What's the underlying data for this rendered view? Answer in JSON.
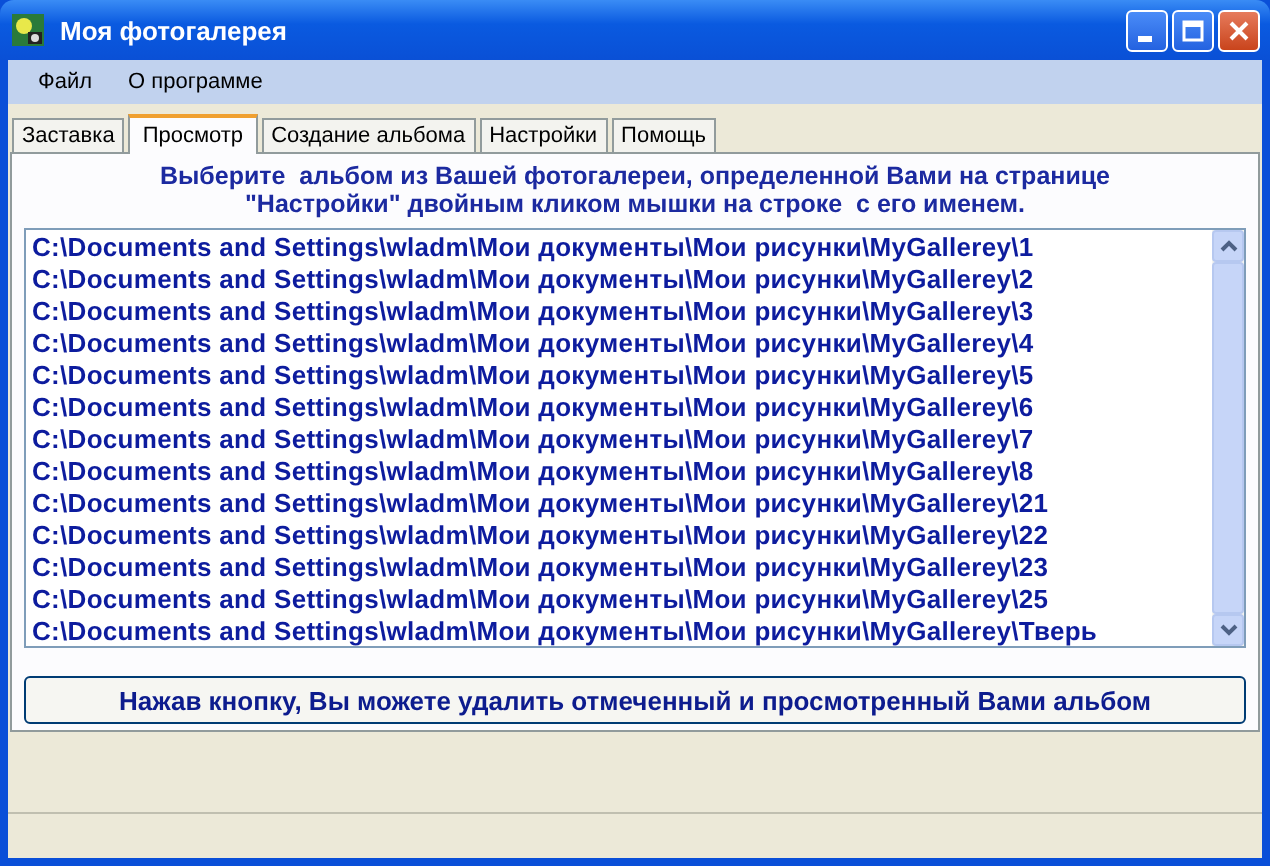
{
  "window": {
    "title": "Моя фотогалерея"
  },
  "menu": [
    "Файл",
    "О программе"
  ],
  "tabs": [
    {
      "label": "Заставка",
      "selected": false
    },
    {
      "label": "Просмотр",
      "selected": true
    },
    {
      "label": "Создание альбома",
      "selected": false
    },
    {
      "label": "Настройки",
      "selected": false
    },
    {
      "label": "Помощь",
      "selected": false
    }
  ],
  "instruction": [
    "Выберите  альбом из Вашей фотогалереи, определенной Вами на странице",
    "\"Настройки\" двойным кликом мышки на строке  с его именем."
  ],
  "albums": [
    "C:\\Documents and Settings\\wladm\\Мои документы\\Мои рисунки\\MyGallerey\\1",
    "C:\\Documents and Settings\\wladm\\Мои документы\\Мои рисунки\\MyGallerey\\2",
    "C:\\Documents and Settings\\wladm\\Мои документы\\Мои рисунки\\MyGallerey\\3",
    "C:\\Documents and Settings\\wladm\\Мои документы\\Мои рисунки\\MyGallerey\\4",
    "C:\\Documents and Settings\\wladm\\Мои документы\\Мои рисунки\\MyGallerey\\5",
    "C:\\Documents and Settings\\wladm\\Мои документы\\Мои рисунки\\MyGallerey\\6",
    "C:\\Documents and Settings\\wladm\\Мои документы\\Мои рисунки\\MyGallerey\\7",
    "C:\\Documents and Settings\\wladm\\Мои документы\\Мои рисунки\\MyGallerey\\8",
    "C:\\Documents and Settings\\wladm\\Мои документы\\Мои рисунки\\MyGallerey\\21",
    "C:\\Documents and Settings\\wladm\\Мои документы\\Мои рисунки\\MyGallerey\\22",
    "C:\\Documents and Settings\\wladm\\Мои документы\\Мои рисунки\\MyGallerey\\23",
    "C:\\Documents and Settings\\wladm\\Мои документы\\Мои рисунки\\MyGallerey\\25",
    "C:\\Documents and Settings\\wladm\\Мои документы\\Мои рисунки\\MyGallerey\\Тверь"
  ],
  "delete_button": "Нажав кнопку, Вы можете удалить отмеченный и просмотренный Вами альбом"
}
